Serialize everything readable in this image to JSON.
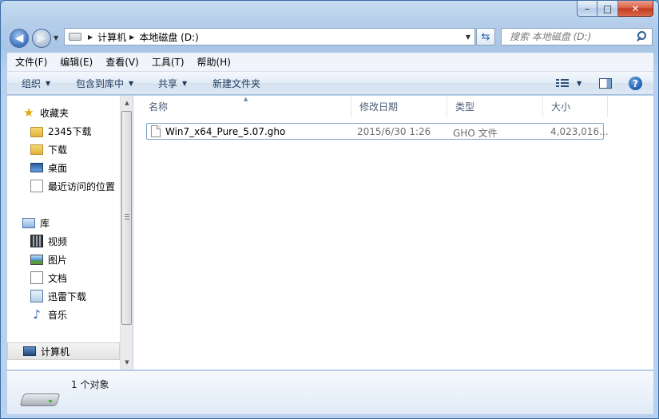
{
  "window": {
    "minimize_glyph": "–",
    "maximize_glyph": "□",
    "close_glyph": "✕"
  },
  "address": {
    "crumbs": [
      "计算机",
      "本地磁盘 (D:)"
    ]
  },
  "search": {
    "placeholder": "搜索 本地磁盘 (D:)"
  },
  "menu": [
    "文件(F)",
    "编辑(E)",
    "查看(V)",
    "工具(T)",
    "帮助(H)"
  ],
  "toolbar": {
    "organize": "组织",
    "include_in_library": "包含到库中",
    "share": "共享",
    "new_folder": "新建文件夹"
  },
  "nav": {
    "favorites": "收藏夹",
    "fav_items": [
      "2345下载",
      "下载",
      "桌面",
      "最近访问的位置"
    ],
    "libraries": "库",
    "lib_items": [
      "视频",
      "图片",
      "文档",
      "迅雷下载",
      "音乐"
    ],
    "computer": "计算机"
  },
  "columns": [
    "名称",
    "修改日期",
    "类型",
    "大小"
  ],
  "files": [
    {
      "name": "Win7_x64_Pure_5.07.gho",
      "modified": "2015/6/30 1:26",
      "type": "GHO 文件",
      "size": "4,023,016..."
    }
  ],
  "details": {
    "count": "1 个对象"
  }
}
